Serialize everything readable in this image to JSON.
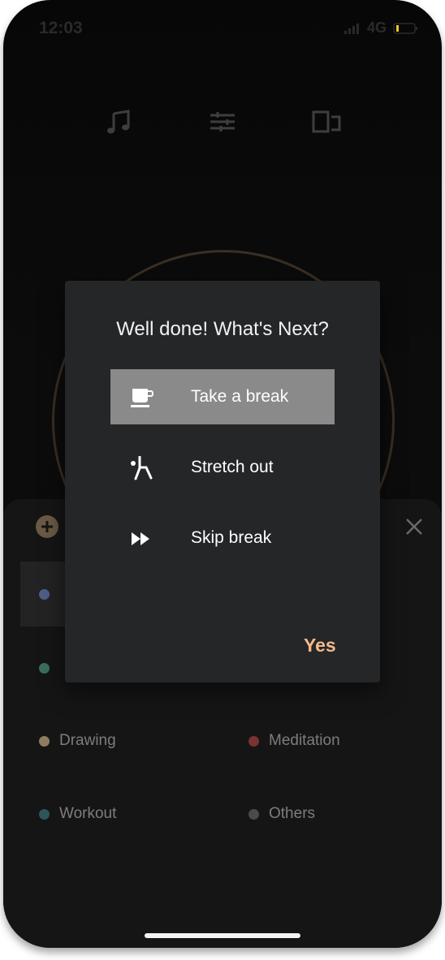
{
  "status_bar": {
    "time": "12:03",
    "network": "4G"
  },
  "top_icons": [
    "music-note-icon",
    "sliders-icon",
    "devices-icon"
  ],
  "categories": [
    {
      "label": "Drawing",
      "color": "#8d7c5e"
    },
    {
      "label": "Meditation",
      "color": "#7a3232"
    },
    {
      "label": "Workout",
      "color": "#2f5558"
    },
    {
      "label": "Others",
      "color": "#4a4a4a"
    }
  ],
  "partial_categories": [
    {
      "color": "#4f5f8a"
    },
    {
      "color": "#3d6e5a"
    }
  ],
  "dialog": {
    "title": "Well done! What's Next?",
    "options": [
      {
        "label": "Take a break",
        "icon": "coffee-cup-icon",
        "selected": true
      },
      {
        "label": "Stretch out",
        "icon": "stretch-figure-icon",
        "selected": false
      },
      {
        "label": "Skip break",
        "icon": "fast-forward-icon",
        "selected": false
      }
    ],
    "confirm_label": "Yes"
  },
  "colors": {
    "accent": "#f1b989",
    "dialog_bg": "#252628",
    "selected_bg": "#8a8a8a"
  }
}
